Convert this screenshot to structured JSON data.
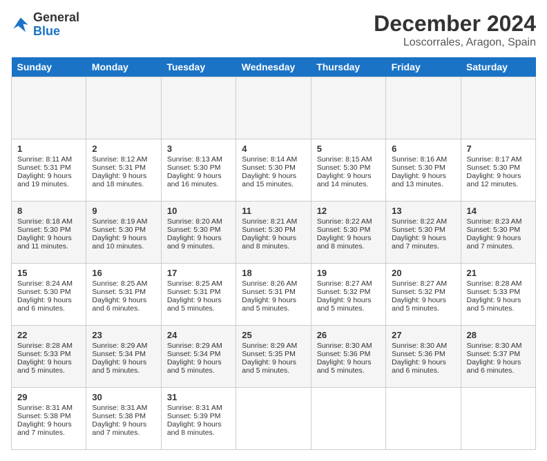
{
  "header": {
    "logo_line1": "General",
    "logo_line2": "Blue",
    "main_title": "December 2024",
    "subtitle": "Loscorrales, Aragon, Spain"
  },
  "calendar": {
    "days_of_week": [
      "Sunday",
      "Monday",
      "Tuesday",
      "Wednesday",
      "Thursday",
      "Friday",
      "Saturday"
    ],
    "weeks": [
      [
        {
          "day": "",
          "content": ""
        },
        {
          "day": "",
          "content": ""
        },
        {
          "day": "",
          "content": ""
        },
        {
          "day": "",
          "content": ""
        },
        {
          "day": "",
          "content": ""
        },
        {
          "day": "",
          "content": ""
        },
        {
          "day": "",
          "content": ""
        }
      ],
      [
        {
          "day": "1",
          "sunrise": "Sunrise: 8:11 AM",
          "sunset": "Sunset: 5:31 PM",
          "daylight": "Daylight: 9 hours and 19 minutes."
        },
        {
          "day": "2",
          "sunrise": "Sunrise: 8:12 AM",
          "sunset": "Sunset: 5:31 PM",
          "daylight": "Daylight: 9 hours and 18 minutes."
        },
        {
          "day": "3",
          "sunrise": "Sunrise: 8:13 AM",
          "sunset": "Sunset: 5:30 PM",
          "daylight": "Daylight: 9 hours and 16 minutes."
        },
        {
          "day": "4",
          "sunrise": "Sunrise: 8:14 AM",
          "sunset": "Sunset: 5:30 PM",
          "daylight": "Daylight: 9 hours and 15 minutes."
        },
        {
          "day": "5",
          "sunrise": "Sunrise: 8:15 AM",
          "sunset": "Sunset: 5:30 PM",
          "daylight": "Daylight: 9 hours and 14 minutes."
        },
        {
          "day": "6",
          "sunrise": "Sunrise: 8:16 AM",
          "sunset": "Sunset: 5:30 PM",
          "daylight": "Daylight: 9 hours and 13 minutes."
        },
        {
          "day": "7",
          "sunrise": "Sunrise: 8:17 AM",
          "sunset": "Sunset: 5:30 PM",
          "daylight": "Daylight: 9 hours and 12 minutes."
        }
      ],
      [
        {
          "day": "8",
          "sunrise": "Sunrise: 8:18 AM",
          "sunset": "Sunset: 5:30 PM",
          "daylight": "Daylight: 9 hours and 11 minutes."
        },
        {
          "day": "9",
          "sunrise": "Sunrise: 8:19 AM",
          "sunset": "Sunset: 5:30 PM",
          "daylight": "Daylight: 9 hours and 10 minutes."
        },
        {
          "day": "10",
          "sunrise": "Sunrise: 8:20 AM",
          "sunset": "Sunset: 5:30 PM",
          "daylight": "Daylight: 9 hours and 9 minutes."
        },
        {
          "day": "11",
          "sunrise": "Sunrise: 8:21 AM",
          "sunset": "Sunset: 5:30 PM",
          "daylight": "Daylight: 9 hours and 8 minutes."
        },
        {
          "day": "12",
          "sunrise": "Sunrise: 8:22 AM",
          "sunset": "Sunset: 5:30 PM",
          "daylight": "Daylight: 9 hours and 8 minutes."
        },
        {
          "day": "13",
          "sunrise": "Sunrise: 8:22 AM",
          "sunset": "Sunset: 5:30 PM",
          "daylight": "Daylight: 9 hours and 7 minutes."
        },
        {
          "day": "14",
          "sunrise": "Sunrise: 8:23 AM",
          "sunset": "Sunset: 5:30 PM",
          "daylight": "Daylight: 9 hours and 7 minutes."
        }
      ],
      [
        {
          "day": "15",
          "sunrise": "Sunrise: 8:24 AM",
          "sunset": "Sunset: 5:30 PM",
          "daylight": "Daylight: 9 hours and 6 minutes."
        },
        {
          "day": "16",
          "sunrise": "Sunrise: 8:25 AM",
          "sunset": "Sunset: 5:31 PM",
          "daylight": "Daylight: 9 hours and 6 minutes."
        },
        {
          "day": "17",
          "sunrise": "Sunrise: 8:25 AM",
          "sunset": "Sunset: 5:31 PM",
          "daylight": "Daylight: 9 hours and 5 minutes."
        },
        {
          "day": "18",
          "sunrise": "Sunrise: 8:26 AM",
          "sunset": "Sunset: 5:31 PM",
          "daylight": "Daylight: 9 hours and 5 minutes."
        },
        {
          "day": "19",
          "sunrise": "Sunrise: 8:27 AM",
          "sunset": "Sunset: 5:32 PM",
          "daylight": "Daylight: 9 hours and 5 minutes."
        },
        {
          "day": "20",
          "sunrise": "Sunrise: 8:27 AM",
          "sunset": "Sunset: 5:32 PM",
          "daylight": "Daylight: 9 hours and 5 minutes."
        },
        {
          "day": "21",
          "sunrise": "Sunrise: 8:28 AM",
          "sunset": "Sunset: 5:33 PM",
          "daylight": "Daylight: 9 hours and 5 minutes."
        }
      ],
      [
        {
          "day": "22",
          "sunrise": "Sunrise: 8:28 AM",
          "sunset": "Sunset: 5:33 PM",
          "daylight": "Daylight: 9 hours and 5 minutes."
        },
        {
          "day": "23",
          "sunrise": "Sunrise: 8:29 AM",
          "sunset": "Sunset: 5:34 PM",
          "daylight": "Daylight: 9 hours and 5 minutes."
        },
        {
          "day": "24",
          "sunrise": "Sunrise: 8:29 AM",
          "sunset": "Sunset: 5:34 PM",
          "daylight": "Daylight: 9 hours and 5 minutes."
        },
        {
          "day": "25",
          "sunrise": "Sunrise: 8:29 AM",
          "sunset": "Sunset: 5:35 PM",
          "daylight": "Daylight: 9 hours and 5 minutes."
        },
        {
          "day": "26",
          "sunrise": "Sunrise: 8:30 AM",
          "sunset": "Sunset: 5:36 PM",
          "daylight": "Daylight: 9 hours and 5 minutes."
        },
        {
          "day": "27",
          "sunrise": "Sunrise: 8:30 AM",
          "sunset": "Sunset: 5:36 PM",
          "daylight": "Daylight: 9 hours and 6 minutes."
        },
        {
          "day": "28",
          "sunrise": "Sunrise: 8:30 AM",
          "sunset": "Sunset: 5:37 PM",
          "daylight": "Daylight: 9 hours and 6 minutes."
        }
      ],
      [
        {
          "day": "29",
          "sunrise": "Sunrise: 8:31 AM",
          "sunset": "Sunset: 5:38 PM",
          "daylight": "Daylight: 9 hours and 7 minutes."
        },
        {
          "day": "30",
          "sunrise": "Sunrise: 8:31 AM",
          "sunset": "Sunset: 5:38 PM",
          "daylight": "Daylight: 9 hours and 7 minutes."
        },
        {
          "day": "31",
          "sunrise": "Sunrise: 8:31 AM",
          "sunset": "Sunset: 5:39 PM",
          "daylight": "Daylight: 9 hours and 8 minutes."
        },
        {
          "day": "",
          "content": ""
        },
        {
          "day": "",
          "content": ""
        },
        {
          "day": "",
          "content": ""
        },
        {
          "day": "",
          "content": ""
        }
      ]
    ]
  }
}
